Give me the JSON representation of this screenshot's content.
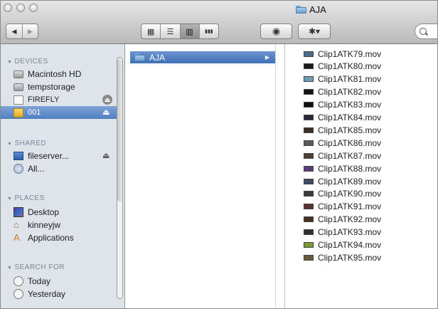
{
  "window": {
    "title": "AJA"
  },
  "toolbar": {
    "back_label": "◀",
    "forward_label": "▶",
    "view_icons_label": "▦",
    "view_list_label": "☰",
    "view_columns_label": "▥",
    "view_coverflow_label": "▮▮▮",
    "quicklook_label": "◉",
    "action_label": "✱▾",
    "search_icon_label": "🔍"
  },
  "sidebar": {
    "sections": [
      {
        "header": "DEVICES"
      },
      {
        "header": "SHARED"
      },
      {
        "header": "PLACES"
      },
      {
        "header": "SEARCH FOR"
      }
    ],
    "devices": [
      {
        "label": "Macintosh HD",
        "icon": "hard-drive-icon"
      },
      {
        "label": "tempstorage",
        "icon": "hard-drive-icon"
      },
      {
        "label": "FIREFLY",
        "icon": "disk-icon"
      },
      {
        "label": "001",
        "icon": "volume-icon"
      }
    ],
    "shared": [
      {
        "label": "fileserver...",
        "icon": "server-icon"
      },
      {
        "label": "All...",
        "icon": "network-icon"
      }
    ],
    "places": [
      {
        "label": "Desktop",
        "icon": "desktop-icon"
      },
      {
        "label": "kinneyjw",
        "icon": "home-icon"
      },
      {
        "label": "Applications",
        "icon": "applications-icon"
      }
    ],
    "search_for": [
      {
        "label": "Today",
        "icon": "clock-icon"
      },
      {
        "label": "Yesterday",
        "icon": "clock-icon"
      }
    ],
    "eject_glyph": "⏏"
  },
  "column1": {
    "selected_item": "AJA",
    "arrow": "▶"
  },
  "column2": {
    "files": [
      {
        "name": "Clip1ATK79.mov",
        "thumb": "#4a6d8c"
      },
      {
        "name": "Clip1ATK80.mov",
        "thumb": "#1b1b1b"
      },
      {
        "name": "Clip1ATK81.mov",
        "thumb": "#6a9fb5"
      },
      {
        "name": "Clip1ATK82.mov",
        "thumb": "#141414"
      },
      {
        "name": "Clip1ATK83.mov",
        "thumb": "#0f0f0f"
      },
      {
        "name": "Clip1ATK84.mov",
        "thumb": "#262a3a"
      },
      {
        "name": "Clip1ATK85.mov",
        "thumb": "#3b2f2a"
      },
      {
        "name": "Clip1ATK86.mov",
        "thumb": "#5a5a5a"
      },
      {
        "name": "Clip1ATK87.mov",
        "thumb": "#4a3f36"
      },
      {
        "name": "Clip1ATK88.mov",
        "thumb": "#5b3d7a"
      },
      {
        "name": "Clip1ATK89.mov",
        "thumb": "#3d4b66"
      },
      {
        "name": "Clip1ATK90.mov",
        "thumb": "#3a3a3a"
      },
      {
        "name": "Clip1ATK91.mov",
        "thumb": "#5a2f2f"
      },
      {
        "name": "Clip1ATK92.mov",
        "thumb": "#443322"
      },
      {
        "name": "Clip1ATK93.mov",
        "thumb": "#2f2f2f"
      },
      {
        "name": "Clip1ATK94.mov",
        "thumb": "#7a9a3a"
      },
      {
        "name": "Clip1ATK95.mov",
        "thumb": "#6b5a3a"
      }
    ]
  }
}
